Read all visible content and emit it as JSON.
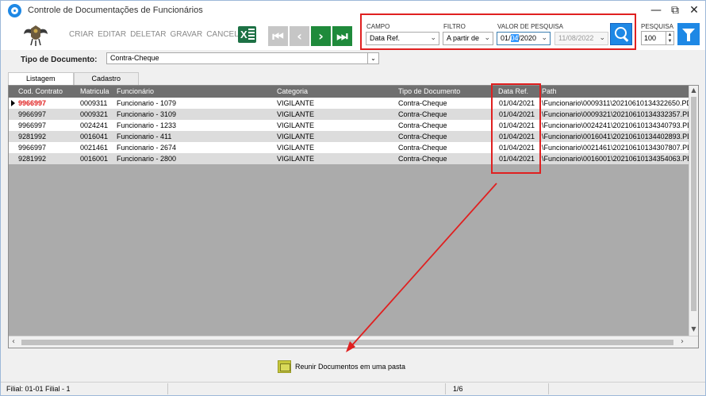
{
  "window": {
    "title": "Controle de Documentações de Funcionários",
    "controls": [
      "—",
      "⧉",
      "✕"
    ]
  },
  "toolbar": {
    "actions": [
      "CRIAR",
      "EDITAR",
      "DELETAR",
      "GRAVAR",
      "CANCELAR"
    ],
    "excel_label": "X",
    "nav": [
      "⏮",
      "‹",
      "›",
      "⏭"
    ]
  },
  "search": {
    "campo_label": "CAMPO",
    "campo_value": "Data Ref.",
    "filtro_label": "FILTRO",
    "filtro_value": "A partir de",
    "valor_label": "VALOR DE PESQUISA",
    "date_from_pre": "01/",
    "date_from_sel": "04",
    "date_from_post": "/2020",
    "date_to": "11/08/2022",
    "pesquisa_label": "PESQUISA",
    "pesquisa_value": "100"
  },
  "document": {
    "label": "Tipo de Documento:",
    "value": "Contra-Cheque"
  },
  "tabs": [
    "Listagem",
    "Cadastro"
  ],
  "grid": {
    "columns": [
      "Cod. Contrato",
      "Matricula",
      "Funcionário",
      "Categoria",
      "Tipo de Documento",
      "Data Ref.",
      "Path"
    ],
    "rows": [
      [
        "9966997",
        "0009311",
        "Funcionario - 1079",
        "VIGILANTE",
        "Contra-Cheque",
        "01/04/2021",
        "\\Funcionario\\0009311\\20210610134322650.PD"
      ],
      [
        "9966997",
        "0009321",
        "Funcionario - 3109",
        "VIGILANTE",
        "Contra-Cheque",
        "01/04/2021",
        "\\Funcionario\\0009321\\20210610134332357.PD"
      ],
      [
        "9966997",
        "0024241",
        "Funcionario - 1233",
        "VIGILANTE",
        "Contra-Cheque",
        "01/04/2021",
        "\\Funcionario\\0024241\\20210610134340793.PD"
      ],
      [
        "9281992",
        "0016041",
        "Funcionario - 411",
        "VIGILANTE",
        "Contra-Cheque",
        "01/04/2021",
        "\\Funcionario\\0016041\\20210610134402893.PD"
      ],
      [
        "9966997",
        "0021461",
        "Funcionario - 2674",
        "VIGILANTE",
        "Contra-Cheque",
        "01/04/2021",
        "\\Funcionario\\0021461\\20210610134307807.PD"
      ],
      [
        "9281992",
        "0016001",
        "Funcionario - 2800",
        "VIGILANTE",
        "Contra-Cheque",
        "01/04/2021",
        "\\Funcionario\\0016001\\20210610134354063.PD"
      ]
    ]
  },
  "reunir_label": "Reunir Documentos em uma pasta",
  "status": {
    "filial": "Filial: 01-01 Filial - 1",
    "record": "1/6"
  },
  "colors": {
    "accent_blue": "#1e88e5",
    "nav_green": "#1f8a3b",
    "annotation_red": "#e02020",
    "header_gray": "#6f6f6f"
  }
}
